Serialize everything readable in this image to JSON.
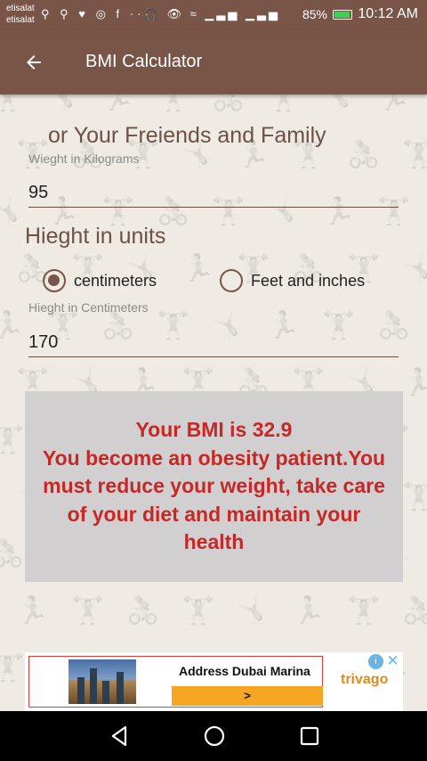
{
  "status_bar": {
    "carrier_line1": "etisalat",
    "carrier_line2": "etisalat",
    "notification_icons": [
      "usb-icon",
      "usb-icon",
      "health-icon",
      "circle-icon",
      "facebook-icon",
      "more-icon"
    ],
    "notification_glyphs": "⚲ ⚲ ♥ ◎ f ···",
    "system_glyphs": "🎧 👁 ≈ ▁▃▅ ▁▃▅",
    "battery": "85%",
    "battery_level": 0.85,
    "time": "10:12 AM"
  },
  "app_bar": {
    "title": "BMI Calculator",
    "back_icon": "arrow-back-icon"
  },
  "form": {
    "subtitle": "or Your Freiends and  Family",
    "weight_label": "Wieght in Kilograms",
    "weight_value": "95",
    "height_heading": "Hieght in units",
    "unit_options": [
      {
        "label": "centimeters",
        "selected": true
      },
      {
        "label": "Feet and inches",
        "selected": false
      }
    ],
    "height_label": "Hieght in Centimeters",
    "height_value": "170"
  },
  "result": {
    "text": "Your BMI is 32.9\nYou become an obesity patient.You must reduce your weight, take care of your diet and maintain your health",
    "color": "#c62828"
  },
  "ad": {
    "title": "Address Dubai Marina",
    "cta": ">",
    "brand": "trivago",
    "info_icon": "info-icon",
    "close_icon": "close-icon"
  },
  "nav_bar": {
    "icons": [
      "nav-back-icon",
      "nav-home-icon",
      "nav-recents-icon"
    ]
  },
  "colors": {
    "primary": "#795548",
    "background": "#efebe4",
    "result_box": "#d1cfcf"
  }
}
